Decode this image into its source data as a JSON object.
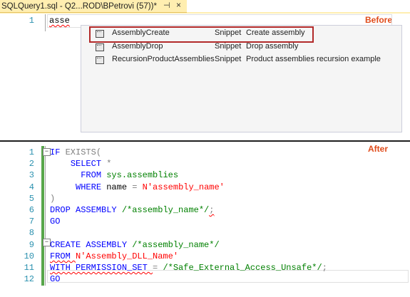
{
  "tab": {
    "title": "SQLQuery1.sql - Q2...ROD\\BPetrovi (57))*",
    "pin_glyph": "⊣",
    "close_glyph": "×"
  },
  "labels": {
    "before": "Before",
    "after": "After"
  },
  "before": {
    "line_number": "1",
    "typed_text": "asse",
    "popup_items": [
      {
        "name": "AssemblyCreate",
        "kind": "Snippet",
        "desc": "Create assembly",
        "icon": "snippet-icon"
      },
      {
        "name": "AssemblyDrop",
        "kind": "Snippet",
        "desc": "Drop assembly",
        "icon": "snippet-icon"
      },
      {
        "name": "RecursionProductAssemblies",
        "kind": "Snippet",
        "desc": "Product assemblies recursion example",
        "icon": "snippet-icon"
      }
    ]
  },
  "after": {
    "line_numbers": [
      "1",
      "2",
      "3",
      "4",
      "5",
      "6",
      "7",
      "8",
      "9",
      "10",
      "11",
      "12"
    ],
    "lines": [
      [
        [
          "kw",
          "IF "
        ],
        [
          "gy",
          "EXISTS("
        ]
      ],
      [
        [
          "",
          "    "
        ],
        [
          "kw",
          "SELECT "
        ],
        [
          "gy",
          "*"
        ]
      ],
      [
        [
          "",
          "      "
        ],
        [
          "kw",
          "FROM "
        ],
        [
          "fn",
          "sys.assemblies"
        ]
      ],
      [
        [
          "",
          "     "
        ],
        [
          "kw",
          "WHERE "
        ],
        [
          "",
          "name "
        ],
        [
          "gy",
          "= "
        ],
        [
          "rd",
          "N'assembly_name'"
        ]
      ],
      [
        [
          "gy",
          ")"
        ]
      ],
      [
        [
          "kw",
          "DROP ASSEMBLY "
        ],
        [
          "gr",
          "/*assembly_name*/"
        ],
        [
          "gy",
          ";"
        ]
      ],
      [
        [
          "kw",
          "GO"
        ]
      ],
      [
        [
          "",
          ""
        ]
      ],
      [
        [
          "kw",
          "CREATE ASSEMBLY "
        ],
        [
          "gr",
          "/*assembly_name*/"
        ]
      ],
      [
        [
          "kw",
          "FROM "
        ],
        [
          "rd",
          "N'Assembly_DLL_Name'"
        ]
      ],
      [
        [
          "kw",
          "WITH PERMISSION_SET "
        ],
        [
          "gy",
          "= "
        ],
        [
          "gr",
          "/*Safe_External_Access_Unsafe*/"
        ],
        [
          "gy",
          ";"
        ]
      ],
      [
        [
          "kw",
          "GO"
        ]
      ]
    ]
  },
  "colors": {
    "keyword": "#0000ff",
    "operator": "#808080",
    "comment": "#008000",
    "string": "#ff0000",
    "line_number": "#2b91af",
    "label": "#e04b1a",
    "selection_frame": "#b22a2a"
  }
}
